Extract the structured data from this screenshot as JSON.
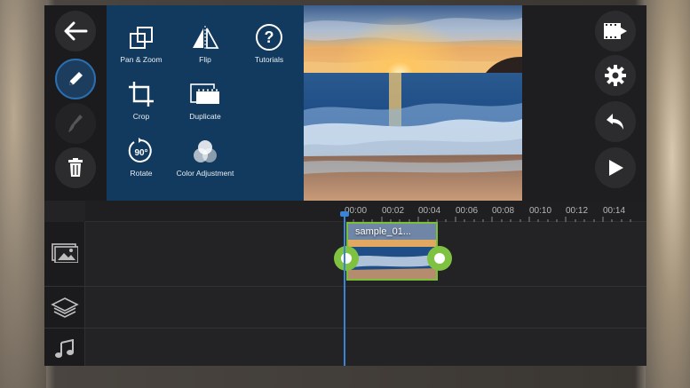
{
  "tools": [
    {
      "label": "Pan & Zoom",
      "icon": "pan-zoom-icon"
    },
    {
      "label": "Flip",
      "icon": "flip-icon"
    },
    {
      "label": "Tutorials",
      "icon": "help-icon"
    },
    {
      "label": "Crop",
      "icon": "crop-icon"
    },
    {
      "label": "Duplicate",
      "icon": "duplicate-icon"
    },
    {
      "label": "Rotate",
      "icon": "rotate-icon",
      "badge": "90°"
    },
    {
      "label": "Color Adjustment",
      "icon": "color-adjustment-icon"
    }
  ],
  "left_rail": [
    "back-arrow-icon",
    "pencil-icon",
    "brush-icon",
    "trash-icon"
  ],
  "right_rail": [
    "export-video-icon",
    "gear-icon",
    "undo-icon",
    "play-icon"
  ],
  "timeline": {
    "ticks": [
      "00:00",
      "00:02",
      "00:04",
      "00:06",
      "00:08",
      "00:10",
      "00:12",
      "00:14"
    ],
    "clip_title": "sample_01...",
    "tracks": [
      "image-track-icon",
      "layers-icon",
      "music-note-icon"
    ]
  },
  "colors": {
    "panel": "#123a5e",
    "accent": "#3a84d6",
    "clip_border": "#7bbf3a"
  }
}
